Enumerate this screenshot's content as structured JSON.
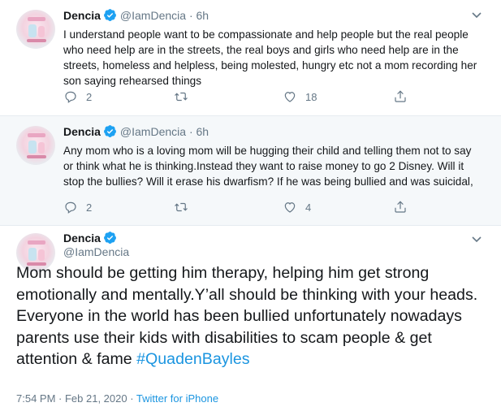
{
  "colors": {
    "verified": "#1da1f2",
    "link": "#1b95e0",
    "muted": "#657786",
    "reply_bg": "#f5f8fa"
  },
  "icons": {
    "reply": "reply-icon",
    "retweet": "retweet-icon",
    "like": "heart-icon",
    "share": "share-icon",
    "more": "chevron-down-icon",
    "verified": "verified-badge-icon"
  },
  "tweets": [
    {
      "name": "Dencia",
      "handle": "@IamDencia",
      "dot": "·",
      "time": "6h",
      "text": "I understand people want to be compassionate and help people but the real people who need help are in the streets, the real boys and girls who need help are in the streets, homeless and helpless, being molested, hungry etc not a mom recording her son saying rehearsed things",
      "replies": "2",
      "retweets": "",
      "likes": "18"
    },
    {
      "name": "Dencia",
      "handle": "@IamDencia",
      "dot": "·",
      "time": "6h",
      "text": "Any mom who is a loving mom will be hugging their child and telling them not to say or think what he is thinking.Instead they want to raise money to go 2 Disney. Will it stop the bullies? Will it erase his dwarfism? If he was being bullied and was suicidal,",
      "replies": "2",
      "retweets": "",
      "likes": "4"
    }
  ],
  "main_tweet": {
    "name": "Dencia",
    "handle": "@IamDencia",
    "text": "Mom should be getting him therapy, helping him get strong emotionally and mentally.Y’all should be thinking with your heads. Everyone in the world has been bullied unfortunately nowadays parents use their kids with disabilities to scam people & get attention & fame ",
    "hashtag": "#QuadenBayles",
    "timestamp": "7:54 PM · Feb 21, 2020 · ",
    "source": "Twitter for iPhone"
  }
}
